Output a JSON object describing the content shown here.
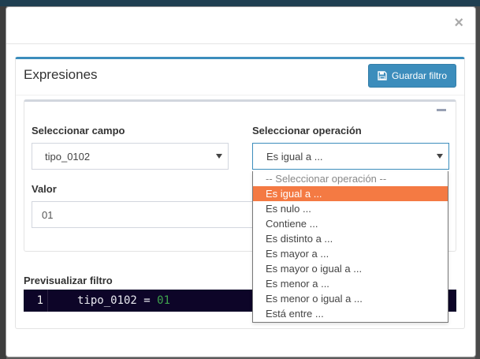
{
  "modal": {
    "close_symbol": "×"
  },
  "box": {
    "title": "Expresiones",
    "save_button_label": "Guardar filtro"
  },
  "form": {
    "field_label": "Seleccionar campo",
    "field_value": "tipo_0102",
    "operation_label": "Seleccionar operación",
    "operation_value": "Es igual a ...",
    "value_label": "Valor",
    "value_input": "01"
  },
  "preview": {
    "label": "Previsualizar filtro",
    "line_number": "1",
    "code_left": "tipo_0102 = ",
    "code_value": "01"
  },
  "operation_options": [
    "-- Seleccionar operación --",
    "Es igual a ...",
    "Es nulo ...",
    "Contiene ...",
    "Es distinto a ...",
    "Es mayor a ...",
    "Es mayor o igual a ...",
    "Es menor a ...",
    "Es menor o igual a ...",
    "Está entre ..."
  ],
  "colors": {
    "primary": "#3c8dbc",
    "highlight": "#f47a43",
    "code_background": "#0d0528"
  },
  "icons": {
    "save": "floppy-disk-icon",
    "close": "close-icon",
    "collapse": "minus-icon"
  }
}
